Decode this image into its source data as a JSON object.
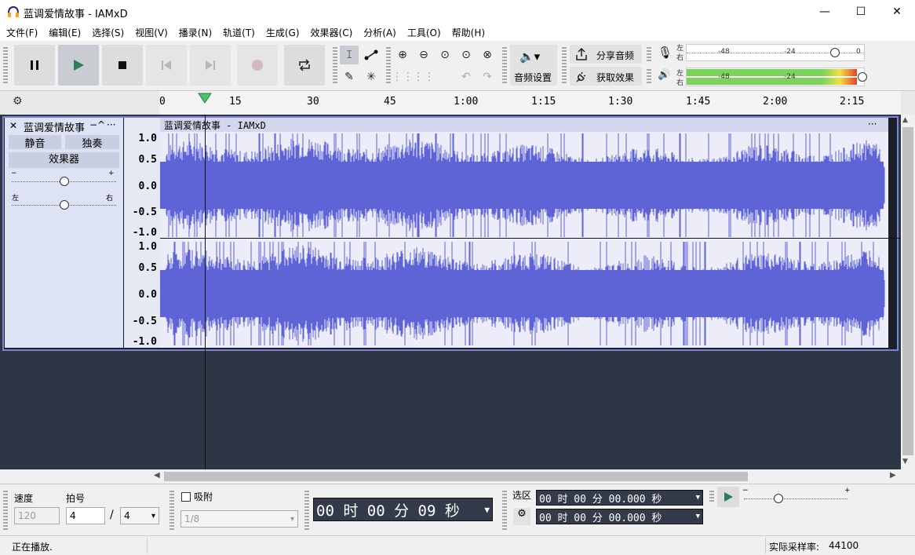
{
  "window": {
    "title": "蓝调爱情故事 - IAMxD",
    "minimize": "—",
    "maximize": "☐",
    "close": "✕"
  },
  "menu": [
    "文件(F)",
    "编辑(E)",
    "选择(S)",
    "视图(V)",
    "播录(N)",
    "轨道(T)",
    "生成(G)",
    "效果器(C)",
    "分析(A)",
    "工具(O)",
    "帮助(H)"
  ],
  "toolbar": {
    "transport": [
      "pause-icon",
      "play-icon",
      "stop-icon",
      "skip-start-icon",
      "skip-end-icon",
      "record-icon",
      "loop-icon"
    ],
    "audio_setup_label": "音频设置",
    "share_audio_label": "分享音频",
    "get_effects_label": "获取效果",
    "record_meter": {
      "marks": [
        "-48",
        "-24",
        "0"
      ],
      "lr": [
        "左",
        "右"
      ]
    },
    "play_meter": {
      "marks": [
        "-48",
        "-24"
      ],
      "lr": [
        "左",
        "右"
      ],
      "level": 0.96
    }
  },
  "ruler": {
    "ticks": [
      "0",
      "15",
      "30",
      "45",
      "1:00",
      "1:15",
      "1:30",
      "1:45",
      "2:00",
      "2:15"
    ]
  },
  "track": {
    "name": "蓝调爱情故事",
    "collapse": "−^",
    "more": "···",
    "mute_label": "静音",
    "solo_label": "独奏",
    "effects_label": "效果器",
    "gain_minus": "−",
    "gain_plus": "+",
    "pan_left": "左",
    "pan_right": "右",
    "clip_title": "蓝调爱情故事 - IAMxD",
    "clip_more": "···",
    "y_labels": [
      "1.0",
      "0.5",
      "0.0",
      "-0.5",
      "-1.0"
    ],
    "gain_level": 0.5,
    "pan_level": 0.5
  },
  "bottom": {
    "tempo_label": "速度",
    "tempo_value": "120",
    "meter_label": "拍号",
    "meter_num": "4",
    "meter_slash": "/",
    "meter_den": "4",
    "snap_label": "吸附",
    "snap_value": "1/8",
    "time_display": "00 时 00 分 09 秒",
    "selection_label": "选区",
    "sel_start": "00 时 00 分 00.000 秒",
    "sel_end": "00 时 00 分 00.000 秒",
    "play_speed_minus": "−",
    "play_speed_plus": "+"
  },
  "status": {
    "message": "正在播放.",
    "rate_label": "实际采样率:",
    "rate_value": "44100"
  },
  "colors": {
    "wave": "#5e63d6",
    "wave_bg": "#ecedf8",
    "track_bg": "#2e3544"
  }
}
